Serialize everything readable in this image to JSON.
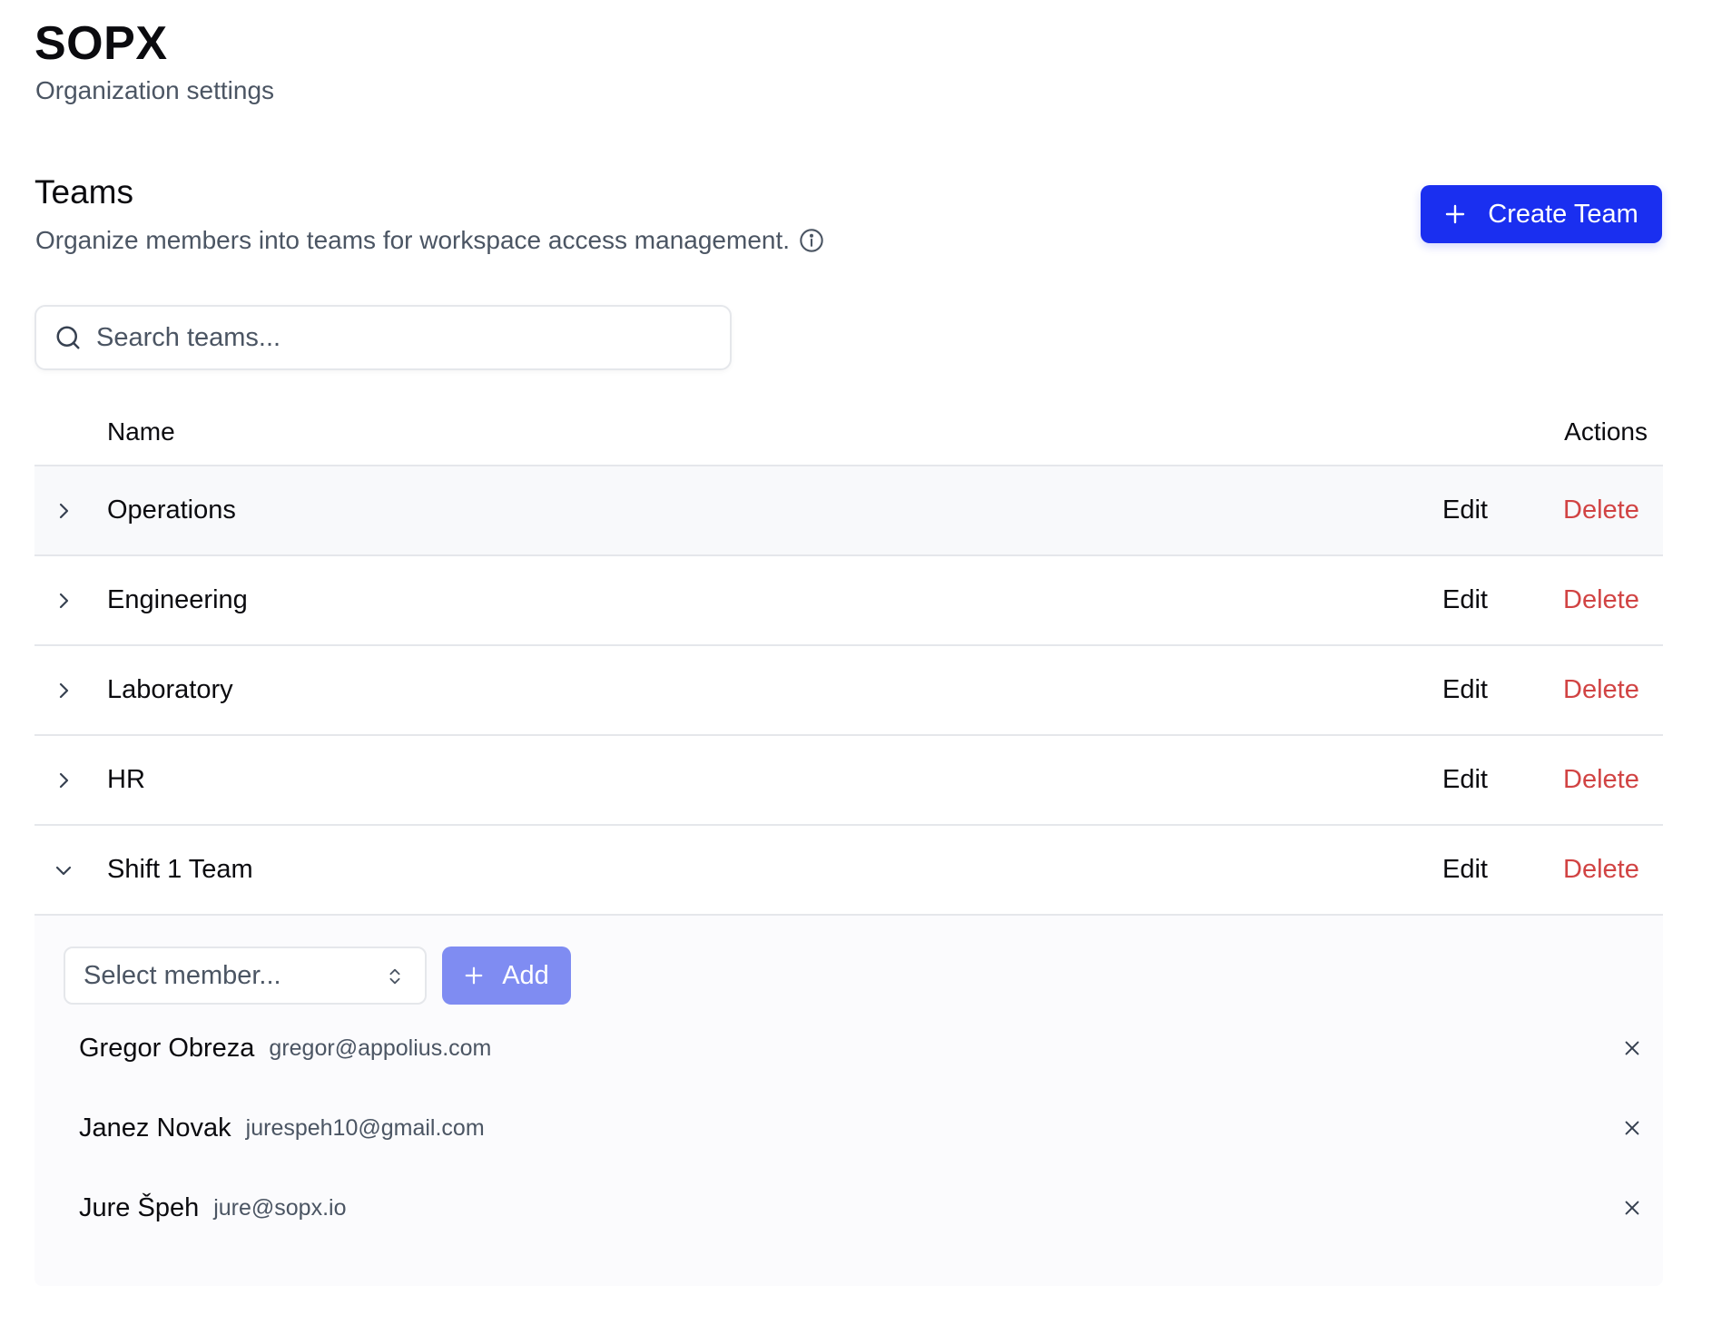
{
  "org": {
    "title": "SOPX",
    "subtitle": "Organization settings"
  },
  "section": {
    "title": "Teams",
    "description": "Organize members into teams for workspace access management.",
    "create_button_label": "Create Team"
  },
  "search": {
    "placeholder": "Search teams..."
  },
  "table": {
    "columns": {
      "name": "Name",
      "actions": "Actions"
    },
    "edit_label": "Edit",
    "delete_label": "Delete",
    "rows": [
      {
        "name": "Operations",
        "expanded": false
      },
      {
        "name": "Engineering",
        "expanded": false
      },
      {
        "name": "Laboratory",
        "expanded": false
      },
      {
        "name": "HR",
        "expanded": false
      },
      {
        "name": "Shift 1 Team",
        "expanded": true
      }
    ]
  },
  "expanded_panel": {
    "select_placeholder": "Select member...",
    "add_button_label": "Add",
    "members": [
      {
        "name": "Gregor Obreza",
        "email": "gregor@appolius.com"
      },
      {
        "name": "Janez Novak",
        "email": "jurespeh10@gmail.com"
      },
      {
        "name": "Jure Špeh",
        "email": "jure@sopx.io"
      }
    ]
  },
  "colors": {
    "primary": "#1a2ff0",
    "add_button": "#7f8cf2",
    "delete": "#d14343",
    "muted_text": "#4b5563",
    "border": "#e5e7eb"
  },
  "icons": {
    "info": "info-icon",
    "plus": "plus-icon",
    "search": "search-icon",
    "chevron_right": "chevron-right-icon",
    "chevron_down": "chevron-down-icon",
    "updown": "chevron-up-down-icon",
    "remove": "close-icon"
  }
}
